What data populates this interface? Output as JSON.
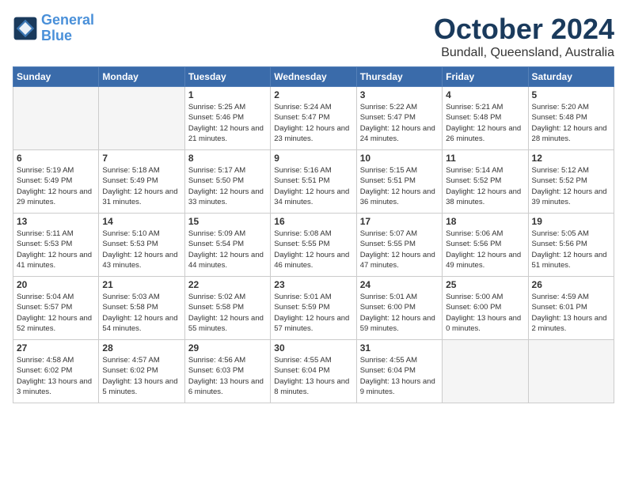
{
  "header": {
    "logo_line1": "General",
    "logo_line2": "Blue",
    "month": "October 2024",
    "location": "Bundall, Queensland, Australia"
  },
  "columns": [
    "Sunday",
    "Monday",
    "Tuesday",
    "Wednesday",
    "Thursday",
    "Friday",
    "Saturday"
  ],
  "weeks": [
    [
      {
        "num": "",
        "empty": true
      },
      {
        "num": "",
        "empty": true
      },
      {
        "num": "1",
        "rise": "5:25 AM",
        "set": "5:46 PM",
        "daylight": "12 hours and 21 minutes."
      },
      {
        "num": "2",
        "rise": "5:24 AM",
        "set": "5:47 PM",
        "daylight": "12 hours and 23 minutes."
      },
      {
        "num": "3",
        "rise": "5:22 AM",
        "set": "5:47 PM",
        "daylight": "12 hours and 24 minutes."
      },
      {
        "num": "4",
        "rise": "5:21 AM",
        "set": "5:48 PM",
        "daylight": "12 hours and 26 minutes."
      },
      {
        "num": "5",
        "rise": "5:20 AM",
        "set": "5:48 PM",
        "daylight": "12 hours and 28 minutes."
      }
    ],
    [
      {
        "num": "6",
        "rise": "5:19 AM",
        "set": "5:49 PM",
        "daylight": "12 hours and 29 minutes."
      },
      {
        "num": "7",
        "rise": "5:18 AM",
        "set": "5:49 PM",
        "daylight": "12 hours and 31 minutes."
      },
      {
        "num": "8",
        "rise": "5:17 AM",
        "set": "5:50 PM",
        "daylight": "12 hours and 33 minutes."
      },
      {
        "num": "9",
        "rise": "5:16 AM",
        "set": "5:51 PM",
        "daylight": "12 hours and 34 minutes."
      },
      {
        "num": "10",
        "rise": "5:15 AM",
        "set": "5:51 PM",
        "daylight": "12 hours and 36 minutes."
      },
      {
        "num": "11",
        "rise": "5:14 AM",
        "set": "5:52 PM",
        "daylight": "12 hours and 38 minutes."
      },
      {
        "num": "12",
        "rise": "5:12 AM",
        "set": "5:52 PM",
        "daylight": "12 hours and 39 minutes."
      }
    ],
    [
      {
        "num": "13",
        "rise": "5:11 AM",
        "set": "5:53 PM",
        "daylight": "12 hours and 41 minutes."
      },
      {
        "num": "14",
        "rise": "5:10 AM",
        "set": "5:53 PM",
        "daylight": "12 hours and 43 minutes."
      },
      {
        "num": "15",
        "rise": "5:09 AM",
        "set": "5:54 PM",
        "daylight": "12 hours and 44 minutes."
      },
      {
        "num": "16",
        "rise": "5:08 AM",
        "set": "5:55 PM",
        "daylight": "12 hours and 46 minutes."
      },
      {
        "num": "17",
        "rise": "5:07 AM",
        "set": "5:55 PM",
        "daylight": "12 hours and 47 minutes."
      },
      {
        "num": "18",
        "rise": "5:06 AM",
        "set": "5:56 PM",
        "daylight": "12 hours and 49 minutes."
      },
      {
        "num": "19",
        "rise": "5:05 AM",
        "set": "5:56 PM",
        "daylight": "12 hours and 51 minutes."
      }
    ],
    [
      {
        "num": "20",
        "rise": "5:04 AM",
        "set": "5:57 PM",
        "daylight": "12 hours and 52 minutes."
      },
      {
        "num": "21",
        "rise": "5:03 AM",
        "set": "5:58 PM",
        "daylight": "12 hours and 54 minutes."
      },
      {
        "num": "22",
        "rise": "5:02 AM",
        "set": "5:58 PM",
        "daylight": "12 hours and 55 minutes."
      },
      {
        "num": "23",
        "rise": "5:01 AM",
        "set": "5:59 PM",
        "daylight": "12 hours and 57 minutes."
      },
      {
        "num": "24",
        "rise": "5:01 AM",
        "set": "6:00 PM",
        "daylight": "12 hours and 59 minutes."
      },
      {
        "num": "25",
        "rise": "5:00 AM",
        "set": "6:00 PM",
        "daylight": "13 hours and 0 minutes."
      },
      {
        "num": "26",
        "rise": "4:59 AM",
        "set": "6:01 PM",
        "daylight": "13 hours and 2 minutes."
      }
    ],
    [
      {
        "num": "27",
        "rise": "4:58 AM",
        "set": "6:02 PM",
        "daylight": "13 hours and 3 minutes."
      },
      {
        "num": "28",
        "rise": "4:57 AM",
        "set": "6:02 PM",
        "daylight": "13 hours and 5 minutes."
      },
      {
        "num": "29",
        "rise": "4:56 AM",
        "set": "6:03 PM",
        "daylight": "13 hours and 6 minutes."
      },
      {
        "num": "30",
        "rise": "4:55 AM",
        "set": "6:04 PM",
        "daylight": "13 hours and 8 minutes."
      },
      {
        "num": "31",
        "rise": "4:55 AM",
        "set": "6:04 PM",
        "daylight": "13 hours and 9 minutes."
      },
      {
        "num": "",
        "empty": true
      },
      {
        "num": "",
        "empty": true
      }
    ]
  ]
}
